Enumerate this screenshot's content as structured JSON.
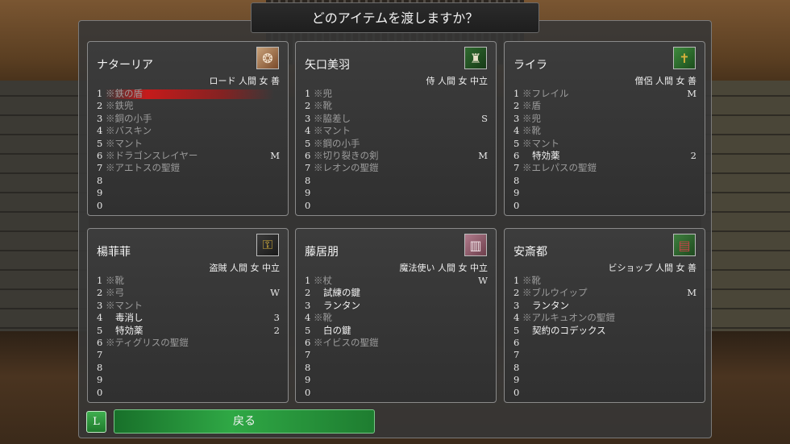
{
  "title": "どのアイテムを渡しますか？",
  "characters": [
    {
      "name": "ナターリア",
      "info": "ロード 人間 女 善",
      "portrait_icon": "dragon-crest-icon",
      "items": [
        {
          "no": "1",
          "name": "※鉄の盾",
          "qty": "",
          "cursed": true,
          "selected": true
        },
        {
          "no": "2",
          "name": "※鉄兜",
          "qty": "",
          "cursed": true
        },
        {
          "no": "3",
          "name": "※銅の小手",
          "qty": "",
          "cursed": true
        },
        {
          "no": "4",
          "name": "※バスキン",
          "qty": "",
          "cursed": true
        },
        {
          "no": "5",
          "name": "※マント",
          "qty": "",
          "cursed": true
        },
        {
          "no": "6",
          "name": "※ドラゴンスレイヤー",
          "qty": "M",
          "cursed": true
        },
        {
          "no": "7",
          "name": "※アエトスの聖鎧",
          "qty": "",
          "cursed": true
        },
        {
          "no": "8",
          "name": "",
          "qty": ""
        },
        {
          "no": "9",
          "name": "",
          "qty": ""
        },
        {
          "no": "0",
          "name": "",
          "qty": ""
        }
      ]
    },
    {
      "name": "矢口美羽",
      "info": "侍 人間 女 中立",
      "portrait_icon": "helmet-icon",
      "items": [
        {
          "no": "1",
          "name": "※兜",
          "qty": "",
          "cursed": true
        },
        {
          "no": "2",
          "name": "※靴",
          "qty": "",
          "cursed": true
        },
        {
          "no": "3",
          "name": "※脇差し",
          "qty": "S",
          "cursed": true
        },
        {
          "no": "4",
          "name": "※マント",
          "qty": "",
          "cursed": true
        },
        {
          "no": "5",
          "name": "※鋼の小手",
          "qty": "",
          "cursed": true
        },
        {
          "no": "6",
          "name": "※切り裂きの剣",
          "qty": "M",
          "cursed": true
        },
        {
          "no": "7",
          "name": "※レオンの聖鎧",
          "qty": "",
          "cursed": true
        },
        {
          "no": "8",
          "name": "",
          "qty": ""
        },
        {
          "no": "9",
          "name": "",
          "qty": ""
        },
        {
          "no": "0",
          "name": "",
          "qty": ""
        }
      ]
    },
    {
      "name": "ライラ",
      "info": "僧侶 人間 女 善",
      "portrait_icon": "cross-icon",
      "items": [
        {
          "no": "1",
          "name": "※フレイル",
          "qty": "M",
          "cursed": true
        },
        {
          "no": "2",
          "name": "※盾",
          "qty": "",
          "cursed": true
        },
        {
          "no": "3",
          "name": "※兜",
          "qty": "",
          "cursed": true
        },
        {
          "no": "4",
          "name": "※靴",
          "qty": "",
          "cursed": true
        },
        {
          "no": "5",
          "name": "※マント",
          "qty": "",
          "cursed": true
        },
        {
          "no": "6",
          "name": "特効薬",
          "qty": "2",
          "cursed": false
        },
        {
          "no": "7",
          "name": "※エレパスの聖鎧",
          "qty": "",
          "cursed": true
        },
        {
          "no": "8",
          "name": "",
          "qty": ""
        },
        {
          "no": "9",
          "name": "",
          "qty": ""
        },
        {
          "no": "0",
          "name": "",
          "qty": ""
        }
      ]
    },
    {
      "name": "楊菲菲",
      "info": "盗賊 人間 女 中立",
      "portrait_icon": "lockpick-icon",
      "items": [
        {
          "no": "1",
          "name": "※靴",
          "qty": "",
          "cursed": true
        },
        {
          "no": "2",
          "name": "※弓",
          "qty": "W",
          "cursed": true
        },
        {
          "no": "3",
          "name": "※マント",
          "qty": "",
          "cursed": true
        },
        {
          "no": "4",
          "name": "毒消し",
          "qty": "3",
          "cursed": false
        },
        {
          "no": "5",
          "name": "特効薬",
          "qty": "2",
          "cursed": false
        },
        {
          "no": "6",
          "name": "※ティグリスの聖鎧",
          "qty": "",
          "cursed": true
        },
        {
          "no": "7",
          "name": "",
          "qty": ""
        },
        {
          "no": "8",
          "name": "",
          "qty": ""
        },
        {
          "no": "9",
          "name": "",
          "qty": ""
        },
        {
          "no": "0",
          "name": "",
          "qty": ""
        }
      ]
    },
    {
      "name": "藤居朋",
      "info": "魔法使い 人間 女 中立",
      "portrait_icon": "spellbook-icon",
      "items": [
        {
          "no": "1",
          "name": "※杖",
          "qty": "W",
          "cursed": true
        },
        {
          "no": "2",
          "name": "試練の鍵",
          "qty": "",
          "cursed": false
        },
        {
          "no": "3",
          "name": "ランタン",
          "qty": "",
          "cursed": false
        },
        {
          "no": "4",
          "name": "※靴",
          "qty": "",
          "cursed": true
        },
        {
          "no": "5",
          "name": "白の鍵",
          "qty": "",
          "cursed": false
        },
        {
          "no": "6",
          "name": "※イビスの聖鎧",
          "qty": "",
          "cursed": true
        },
        {
          "no": "7",
          "name": "",
          "qty": ""
        },
        {
          "no": "8",
          "name": "",
          "qty": ""
        },
        {
          "no": "9",
          "name": "",
          "qty": ""
        },
        {
          "no": "0",
          "name": "",
          "qty": ""
        }
      ]
    },
    {
      "name": "安斎都",
      "info": "ビショップ 人間 女 善",
      "portrait_icon": "tome-icon",
      "items": [
        {
          "no": "1",
          "name": "※靴",
          "qty": "",
          "cursed": true
        },
        {
          "no": "2",
          "name": "※ブルウイップ",
          "qty": "M",
          "cursed": true
        },
        {
          "no": "3",
          "name": "ランタン",
          "qty": "",
          "cursed": false
        },
        {
          "no": "4",
          "name": "※アルキュオンの聖鎧",
          "qty": "",
          "cursed": true
        },
        {
          "no": "5",
          "name": "契約のコデックス",
          "qty": "",
          "cursed": false
        },
        {
          "no": "6",
          "name": "",
          "qty": ""
        },
        {
          "no": "7",
          "name": "",
          "qty": ""
        },
        {
          "no": "8",
          "name": "",
          "qty": ""
        },
        {
          "no": "9",
          "name": "",
          "qty": ""
        },
        {
          "no": "0",
          "name": "",
          "qty": ""
        }
      ]
    }
  ],
  "footer": {
    "l_button_label": "L",
    "back_button_label": "戻る"
  },
  "colors": {
    "selection": "#cc1a1a",
    "button_green": "#2fa845"
  }
}
